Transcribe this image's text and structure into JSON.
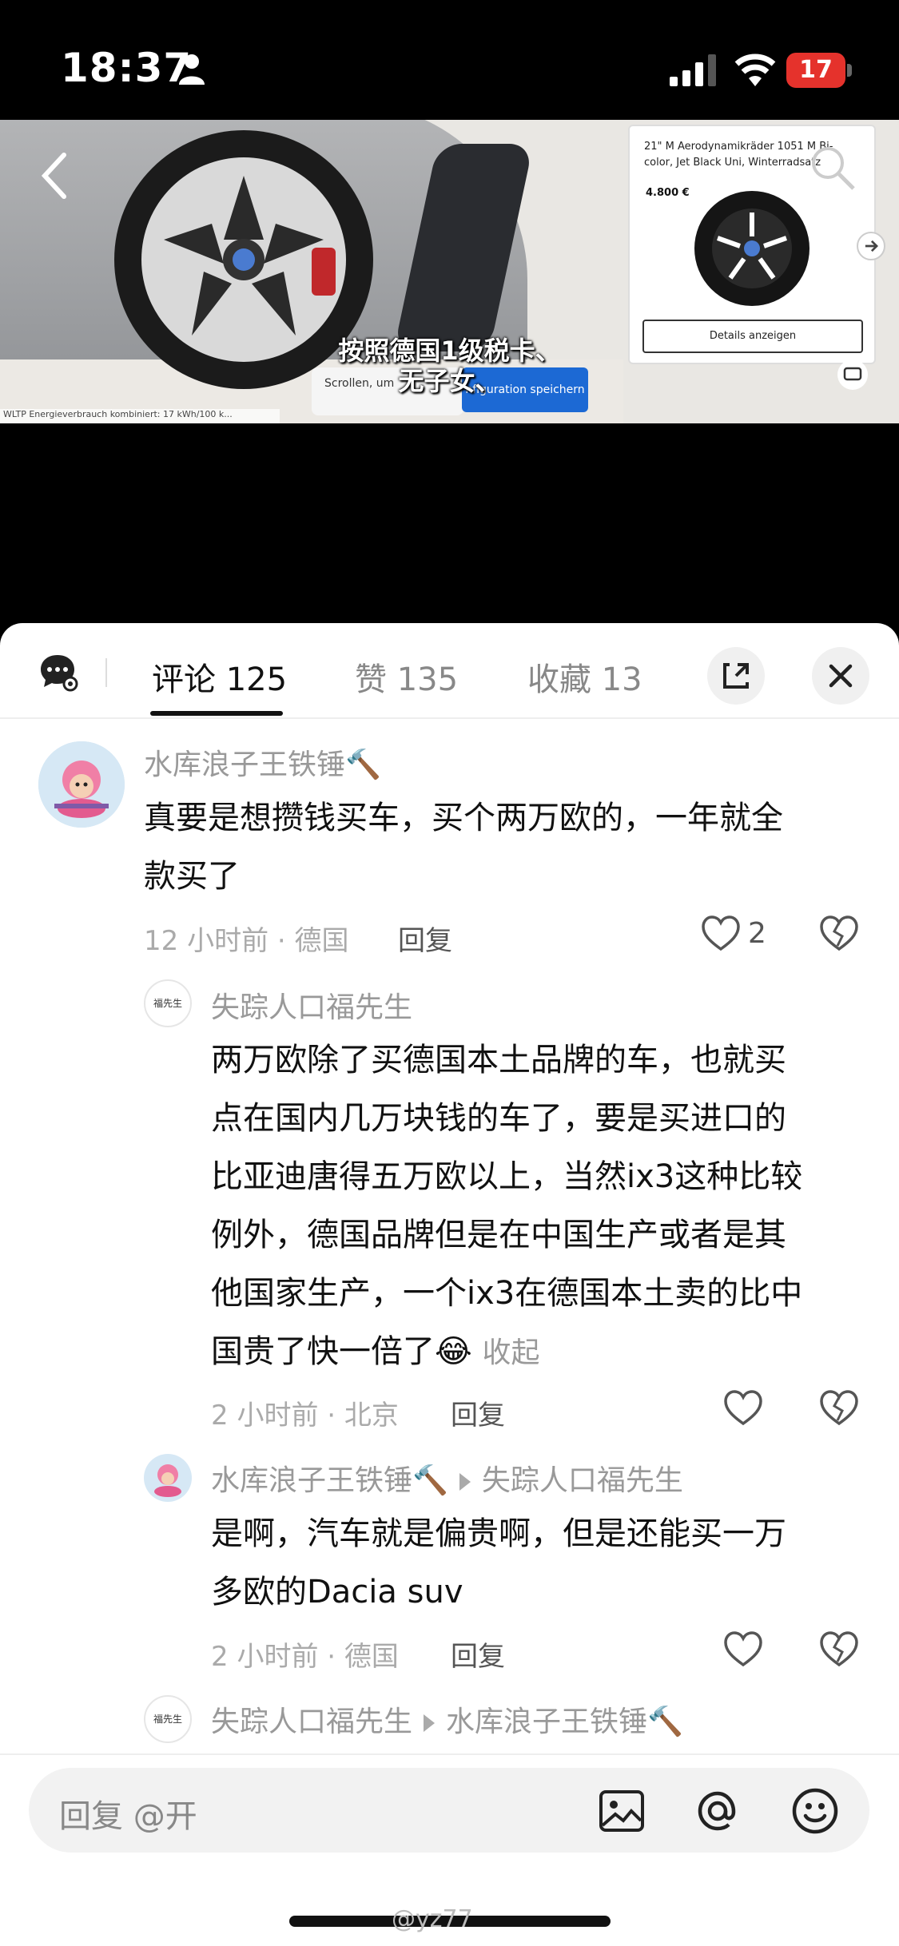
{
  "status_bar": {
    "time": "18:37",
    "battery": "17"
  },
  "video": {
    "config_panel": {
      "title": "21\" M Aerodynamikräder 1051 M Bi-color, Jet Black Uni, Winterradsatz",
      "price": "4.800 €",
      "button": "Details anzeigen"
    },
    "scroll_hint": "Scrollen, um",
    "save_button": "nfiguration speichern",
    "subtitle_line1": "按照德国1级税卡、",
    "subtitle_line2": "无子女、",
    "wltp_text": "WLTP Energieverbrauch kombiniert: 17 kWh/100 k..."
  },
  "tabs": {
    "comments": "评论 125",
    "likes": "赞 135",
    "favorites": "收藏 13"
  },
  "comments": [
    {
      "author": "水库浪子王铁锤🔨",
      "text_line1": "真要是想攒钱买车，买个两万欧的，一年就全",
      "text_line2": "款买了",
      "meta": "12 小时前 · 德国",
      "reply": "回复",
      "likes": "2"
    },
    {
      "author": "失踪人口福先生",
      "avatar_text": "福先生",
      "lines": [
        "两万欧除了买德国本土品牌的车，也就买",
        "点在国内几万块钱的车了，要是买进口的",
        "比亚迪唐得五万欧以上，当然ix3这种比较",
        "例外，德国品牌但是在中国生产或者是其",
        "他国家生产，一个ix3在德国本土卖的比中",
        "国贵了快一倍了😂"
      ],
      "collapse": "收起",
      "meta": "2 小时前 · 北京",
      "reply": "回复"
    },
    {
      "author": "水库浪子王铁锤🔨",
      "reply_to": "失踪人口福先生",
      "text_line1": "是啊，汽车就是偏贵啊，但是还能买一万",
      "text_line2": "多欧的Dacia suv",
      "meta": "2 小时前 · 德国",
      "reply": "回复"
    },
    {
      "author": "失踪人口福先生",
      "avatar_text": "福先生",
      "reply_to": "水库浪子王铁锤🔨"
    }
  ],
  "reply_bar": {
    "placeholder": "回复 @开"
  },
  "watermark": "@yz77",
  "colors": {
    "accent_blue": "#1c69d4",
    "battery_red": "#e5322c"
  }
}
